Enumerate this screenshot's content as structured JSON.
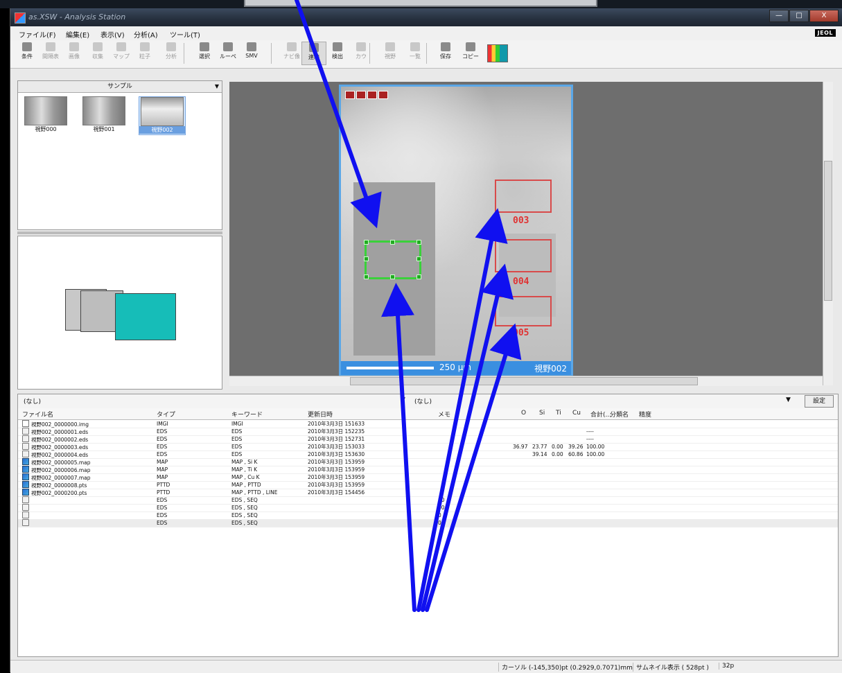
{
  "app": {
    "title": "as.XSW - Analysis Station",
    "window_buttons": [
      "—",
      "□",
      "X"
    ]
  },
  "menu": [
    "ファイル(F)",
    "編集(E)",
    "表示(V)",
    "分析(A)",
    "ツール(T)"
  ],
  "brand": "JEOL",
  "toolbar": [
    {
      "label": "条件",
      "state": "normal"
    },
    {
      "label": "間隔表",
      "state": "disabled"
    },
    {
      "label": "画像",
      "state": "disabled"
    },
    {
      "label": "収集",
      "state": "disabled"
    },
    {
      "label": "マップ",
      "state": "disabled"
    },
    {
      "label": "粒子",
      "state": "disabled"
    },
    {
      "label": "分析",
      "state": "disabled"
    },
    {
      "label": "選択",
      "state": "normal"
    },
    {
      "label": "ルーペ",
      "state": "normal"
    },
    {
      "label": "SMV",
      "state": "normal"
    },
    {
      "label": "ナビ像",
      "state": "disabled"
    },
    {
      "label": "連続",
      "state": "active"
    },
    {
      "label": "検出",
      "state": "normal"
    },
    {
      "label": "カウ",
      "state": "disabled"
    },
    {
      "label": "視野",
      "state": "disabled"
    },
    {
      "label": "一覧",
      "state": "disabled"
    },
    {
      "label": "保存",
      "state": "normal"
    },
    {
      "label": "コピー",
      "state": "normal"
    }
  ],
  "sample_panel": {
    "header": "サンプル",
    "thumbnails": [
      {
        "label": "視野000",
        "selected": false
      },
      {
        "label": "視野001",
        "selected": false
      },
      {
        "label": "視野002",
        "selected": true
      }
    ]
  },
  "image_view": {
    "scale_text": "250 µm",
    "view_name": "視野002",
    "roi_labels": [
      "003",
      "004",
      "005"
    ]
  },
  "file_list": {
    "left_filter": "(なし)",
    "right_filter": "(なし)",
    "settings_button": "設定",
    "columns": [
      "ファイル名",
      "タイプ",
      "キーワード",
      "更新日時",
      "メモ",
      "O",
      "Si",
      "Ti",
      "Cu",
      "合計(...",
      "分類名",
      "精度"
    ],
    "rows": [
      {
        "icon": "img",
        "name": "視野002_0000000.img",
        "type": "IMGI",
        "keyword": "IMGI",
        "date": "2010年3月3日 151633",
        "memo": "",
        "O": "",
        "Si": "",
        "Ti": "",
        "Cu": "",
        "total": ""
      },
      {
        "icon": "eds",
        "name": "視野002_0000001.eds",
        "type": "EDS",
        "keyword": "EDS",
        "date": "2010年3月3日 152235",
        "memo": "",
        "O": "",
        "Si": "",
        "Ti": "",
        "Cu": "",
        "total": "----"
      },
      {
        "icon": "eds",
        "name": "視野002_0000002.eds",
        "type": "EDS",
        "keyword": "EDS",
        "date": "2010年3月3日 152731",
        "memo": "",
        "O": "",
        "Si": "",
        "Ti": "",
        "Cu": "",
        "total": "----"
      },
      {
        "icon": "eds",
        "name": "視野002_0000003.eds",
        "type": "EDS",
        "keyword": "EDS",
        "date": "2010年3月3日 153033",
        "memo": "",
        "O": "36.97",
        "Si": "23.77",
        "Ti": "0.00",
        "Cu": "39.26",
        "total": "100.00"
      },
      {
        "icon": "eds",
        "name": "視野002_0000004.eds",
        "type": "EDS",
        "keyword": "EDS",
        "date": "2010年3月3日 153630",
        "memo": "",
        "O": "",
        "Si": "39.14",
        "Ti": "0.00",
        "Cu": "60.86",
        "total": "100.00"
      },
      {
        "icon": "map",
        "name": "視野002_0000005.map",
        "type": "MAP",
        "keyword": "MAP , Si K",
        "date": "2010年3月3日 153959",
        "memo": "",
        "O": "",
        "Si": "",
        "Ti": "",
        "Cu": "",
        "total": ""
      },
      {
        "icon": "map",
        "name": "視野002_0000006.map",
        "type": "MAP",
        "keyword": "MAP , Ti K",
        "date": "2010年3月3日 153959",
        "memo": "",
        "O": "",
        "Si": "",
        "Ti": "",
        "Cu": "",
        "total": ""
      },
      {
        "icon": "map",
        "name": "視野002_0000007.map",
        "type": "MAP",
        "keyword": "MAP , Cu K",
        "date": "2010年3月3日 153959",
        "memo": "",
        "O": "",
        "Si": "",
        "Ti": "",
        "Cu": "",
        "total": ""
      },
      {
        "icon": "map",
        "name": "視野002_0000008.pts",
        "type": "PTTD",
        "keyword": "MAP , PTTD",
        "date": "2010年3月3日 153959",
        "memo": "",
        "O": "",
        "Si": "",
        "Ti": "",
        "Cu": "",
        "total": ""
      },
      {
        "icon": "map",
        "name": "視野002_0000200.pts",
        "type": "PTTD",
        "keyword": "MAP , PTTD , LINE",
        "date": "2010年3月3日 154456",
        "memo": "",
        "O": "",
        "Si": "",
        "Ti": "",
        "Cu": "",
        "total": ""
      },
      {
        "icon": "eds",
        "name": "",
        "type": "EDS",
        "keyword": "EDS , SEQ",
        "date": "",
        "memo": "00",
        "O": "",
        "Si": "",
        "Ti": "",
        "Cu": "",
        "total": ""
      },
      {
        "icon": "eds",
        "name": "",
        "type": "EDS",
        "keyword": "EDS , SEQ",
        "date": "",
        "memo": "00",
        "O": "",
        "Si": "",
        "Ti": "",
        "Cu": "",
        "total": ""
      },
      {
        "icon": "eds",
        "name": "",
        "type": "EDS",
        "keyword": "EDS , SEQ",
        "date": "",
        "memo": "0",
        "O": "",
        "Si": "",
        "Ti": "",
        "Cu": "",
        "total": ""
      },
      {
        "icon": "eds",
        "name": "",
        "type": "EDS",
        "keyword": "EDS , SEQ",
        "date": "",
        "memo": "0",
        "O": "",
        "Si": "",
        "Ti": "",
        "Cu": "",
        "total": ""
      }
    ]
  },
  "status": {
    "cursor": "カーソル (-145,350)pt (0.2929,0.7071)mm",
    "thumbnail": "サムネイル表示 ( 528pt )",
    "size": "32p"
  },
  "colors": {
    "roi_red": "#d84a4a",
    "roi_green": "#3ad13a",
    "arrow_blue": "#1010f0",
    "scale_bar_blue": "#3a8fe0"
  }
}
